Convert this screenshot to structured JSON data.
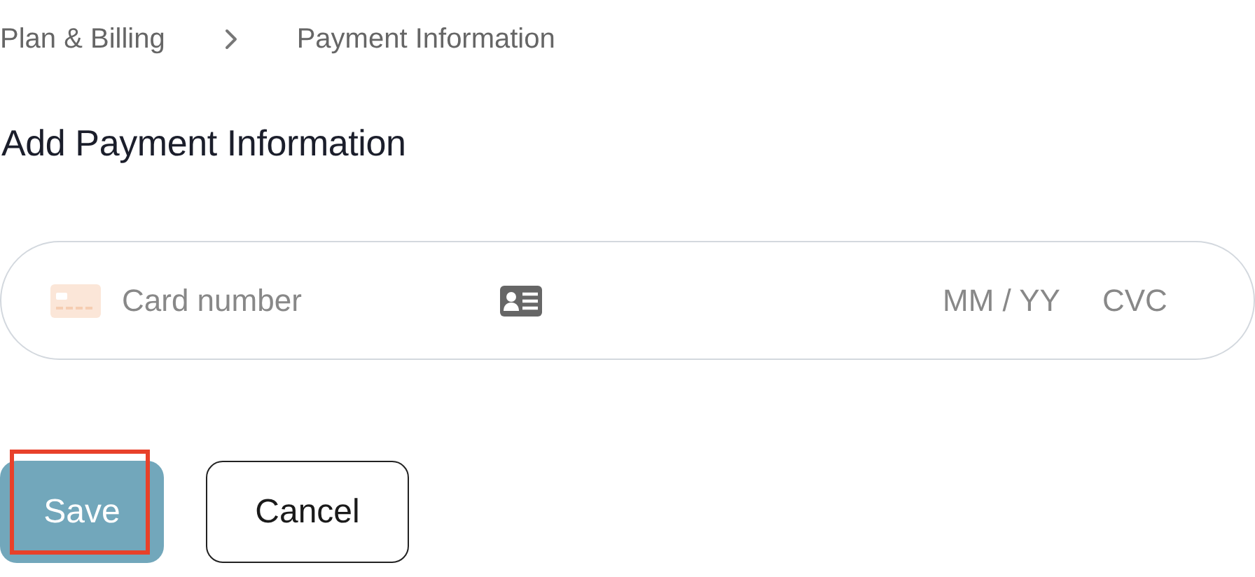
{
  "breadcrumb": [
    {
      "label": "Plan & Billing"
    },
    {
      "label": "Payment Information"
    }
  ],
  "heading": "Add Payment Information",
  "card_field": {
    "placeholder": "Card number",
    "expiry_placeholder": "MM / YY",
    "cvc_placeholder": "CVC"
  },
  "buttons": [
    {
      "label": "Save",
      "kind": "primary",
      "highlighted": true
    },
    {
      "label": "Cancel",
      "kind": "secondary",
      "highlighted": false
    }
  ]
}
